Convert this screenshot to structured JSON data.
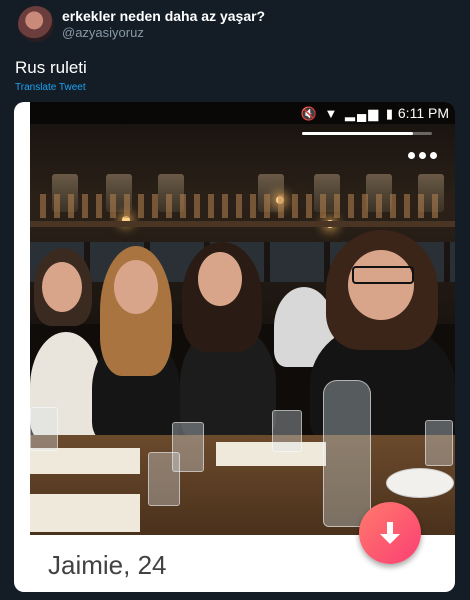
{
  "tweet": {
    "author_name": "erkekler neden daha az yaşar?",
    "author_handle": "@azyasiyoruz",
    "text": "Rus ruleti",
    "translate_label": "Translate Tweet"
  },
  "phone": {
    "time": "6:11 PM",
    "status_icons": "🔇 ▼ ▂▄▆ ▮",
    "story_progress": 0.85
  },
  "profile": {
    "name_age": "Jaimie, 24"
  },
  "icons": {
    "avatar": "profile-photo",
    "fab": "arrow-down-icon",
    "more": "more-dots-icon"
  },
  "colors": {
    "background": "#141d26",
    "link": "#1da1f2",
    "fab_gradient_start": "#ff7a6b",
    "fab_gradient_end": "#fb3f74"
  }
}
